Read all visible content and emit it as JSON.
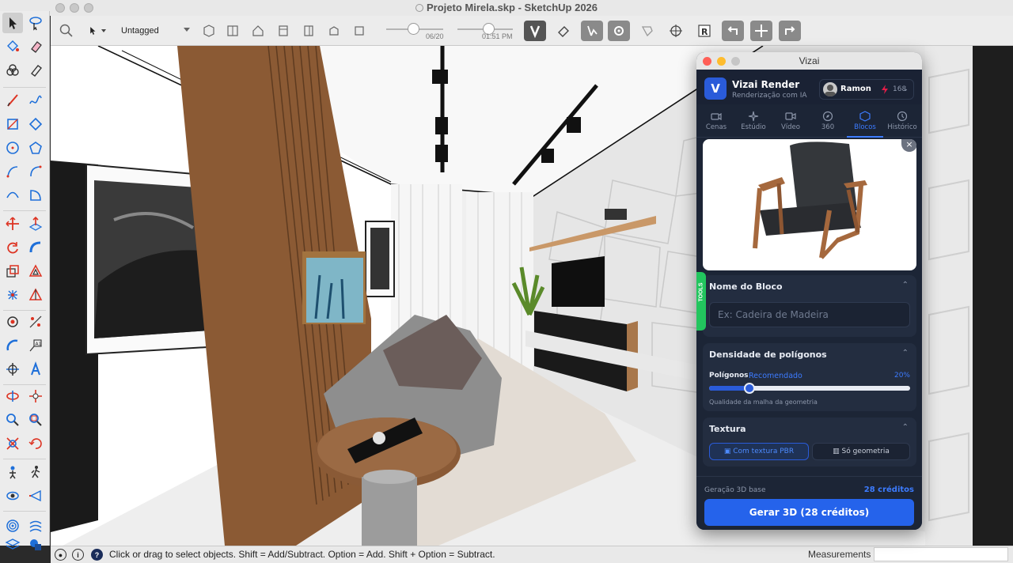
{
  "window": {
    "title": "Projeto Mirela.skp - SketchUp 2026"
  },
  "toolbar": {
    "tag_select": "Untagged",
    "scene_slider_label": "06/20",
    "time_slider_label": "01:51 PM"
  },
  "status": {
    "hint": "Click or drag to select objects. Shift = Add/Subtract. Option = Add. Shift + Option = Subtract.",
    "measurements_label": "Measurements",
    "measurements_value": ""
  },
  "vizai": {
    "window_title": "Vizai",
    "brand": "Vizai Render",
    "subtitle": "Renderização com IA",
    "logo_letter": "V",
    "user_name": "Ramon",
    "credits": "168",
    "tabs": [
      {
        "label": "Cenas",
        "icon": "camera-icon"
      },
      {
        "label": "Estúdio",
        "icon": "sparkle-icon"
      },
      {
        "label": "Vídeo",
        "icon": "video-icon"
      },
      {
        "label": "360",
        "icon": "compass-icon"
      },
      {
        "label": "Blocos",
        "icon": "cube-icon"
      },
      {
        "label": "Histórico",
        "icon": "clock-icon"
      }
    ],
    "active_tab": "Blocos",
    "preview_close": "×",
    "tools_tab": "TOOLS",
    "block_name": {
      "heading": "Nome do Bloco",
      "placeholder": "Ex: Cadeira de Madeira",
      "value": ""
    },
    "density": {
      "heading": "Densidade de polígonos",
      "label": "Polígonos",
      "recommended": "Recomendado",
      "percent": "20%",
      "value_fraction": 0.2,
      "hint": "Qualidade da malha da geometria"
    },
    "texture": {
      "heading": "Textura",
      "option_pbr": "Com textura PBR",
      "option_geo": "Só geometria",
      "selected": "Com textura PBR"
    },
    "footer": {
      "label": "Geração 3D base",
      "credits": "28 créditos",
      "button": "Gerar 3D (28 créditos)"
    },
    "colors": {
      "accent": "#2563eb",
      "panel": "#1c2536",
      "tools": "#22c55e"
    }
  }
}
